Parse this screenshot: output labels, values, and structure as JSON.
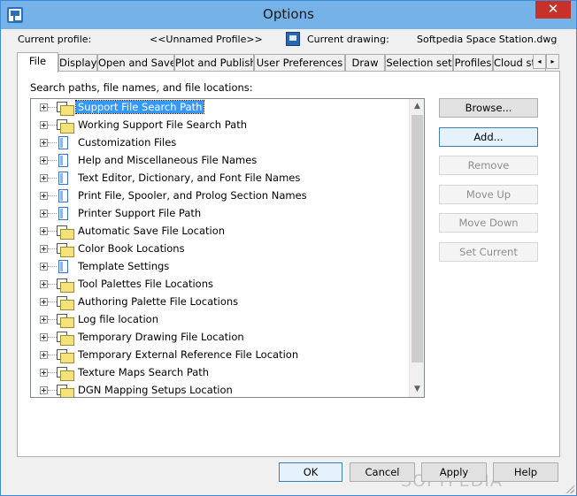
{
  "window": {
    "title": "Options",
    "close_glyph": "✕"
  },
  "profile": {
    "current_profile_label": "Current profile:",
    "current_profile_value": "<<Unnamed Profile>>",
    "current_drawing_label": "Current drawing:",
    "current_drawing_value": "Softpedia Space Station.dwg"
  },
  "tabs": [
    {
      "label": "File"
    },
    {
      "label": "Display"
    },
    {
      "label": "Open and Save"
    },
    {
      "label": "Plot and Publish"
    },
    {
      "label": "User Preferences"
    },
    {
      "label": "Draw"
    },
    {
      "label": "Selection set"
    },
    {
      "label": "Profiles"
    },
    {
      "label": "Cloud stora"
    }
  ],
  "tab_scroll": {
    "left": "◂",
    "right": "▸"
  },
  "panel": {
    "label": "Search paths, file names, and file locations:"
  },
  "tree": {
    "items": [
      {
        "label": "Support File Search Path",
        "icon": "folder",
        "selected": true
      },
      {
        "label": "Working Support File Search Path",
        "icon": "folder"
      },
      {
        "label": "Customization Files",
        "icon": "file"
      },
      {
        "label": "Help and Miscellaneous File Names",
        "icon": "file"
      },
      {
        "label": "Text Editor, Dictionary, and Font File Names",
        "icon": "file"
      },
      {
        "label": "Print File, Spooler, and Prolog Section Names",
        "icon": "file"
      },
      {
        "label": "Printer Support File Path",
        "icon": "file"
      },
      {
        "label": "Automatic Save File Location",
        "icon": "folder"
      },
      {
        "label": "Color Book Locations",
        "icon": "folder"
      },
      {
        "label": "Template Settings",
        "icon": "file"
      },
      {
        "label": "Tool Palettes File Locations",
        "icon": "folder"
      },
      {
        "label": "Authoring Palette File Locations",
        "icon": "folder"
      },
      {
        "label": "Log file location",
        "icon": "folder"
      },
      {
        "label": "Temporary Drawing File Location",
        "icon": "folder"
      },
      {
        "label": "Temporary External Reference File Location",
        "icon": "folder"
      },
      {
        "label": "Texture Maps Search Path",
        "icon": "folder"
      },
      {
        "label": "DGN Mapping Setups Location",
        "icon": "folder"
      }
    ],
    "scroll_up": "▲",
    "scroll_down": "▼"
  },
  "side_buttons": {
    "browse": "Browse...",
    "add": "Add...",
    "remove": "Remove",
    "move_up": "Move Up",
    "move_down": "Move Down",
    "set_current": "Set Current"
  },
  "footer": {
    "ok": "OK",
    "cancel": "Cancel",
    "apply": "Apply",
    "help": "Help"
  },
  "watermark": "SOFTPEDIA",
  "colors": {
    "titlebar": "#74b2e8",
    "close": "#c7312a",
    "selection": "#3399ff"
  }
}
